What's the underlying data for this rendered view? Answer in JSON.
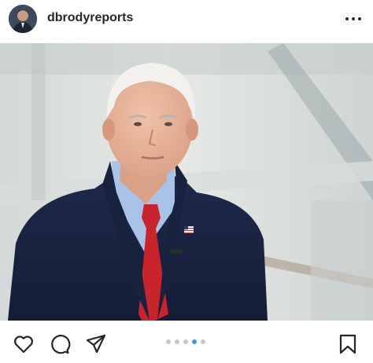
{
  "post": {
    "username": "dbrodyreports",
    "carousel": {
      "total": 5,
      "active": 4
    }
  },
  "icons": {
    "more": "more-horizontal-icon",
    "like": "heart-icon",
    "comment": "comment-icon",
    "share": "paper-plane-icon",
    "save": "bookmark-icon"
  },
  "colors": {
    "text": "#262626",
    "dot_inactive": "#c7c7c7",
    "dot_active": "#3897f0"
  }
}
